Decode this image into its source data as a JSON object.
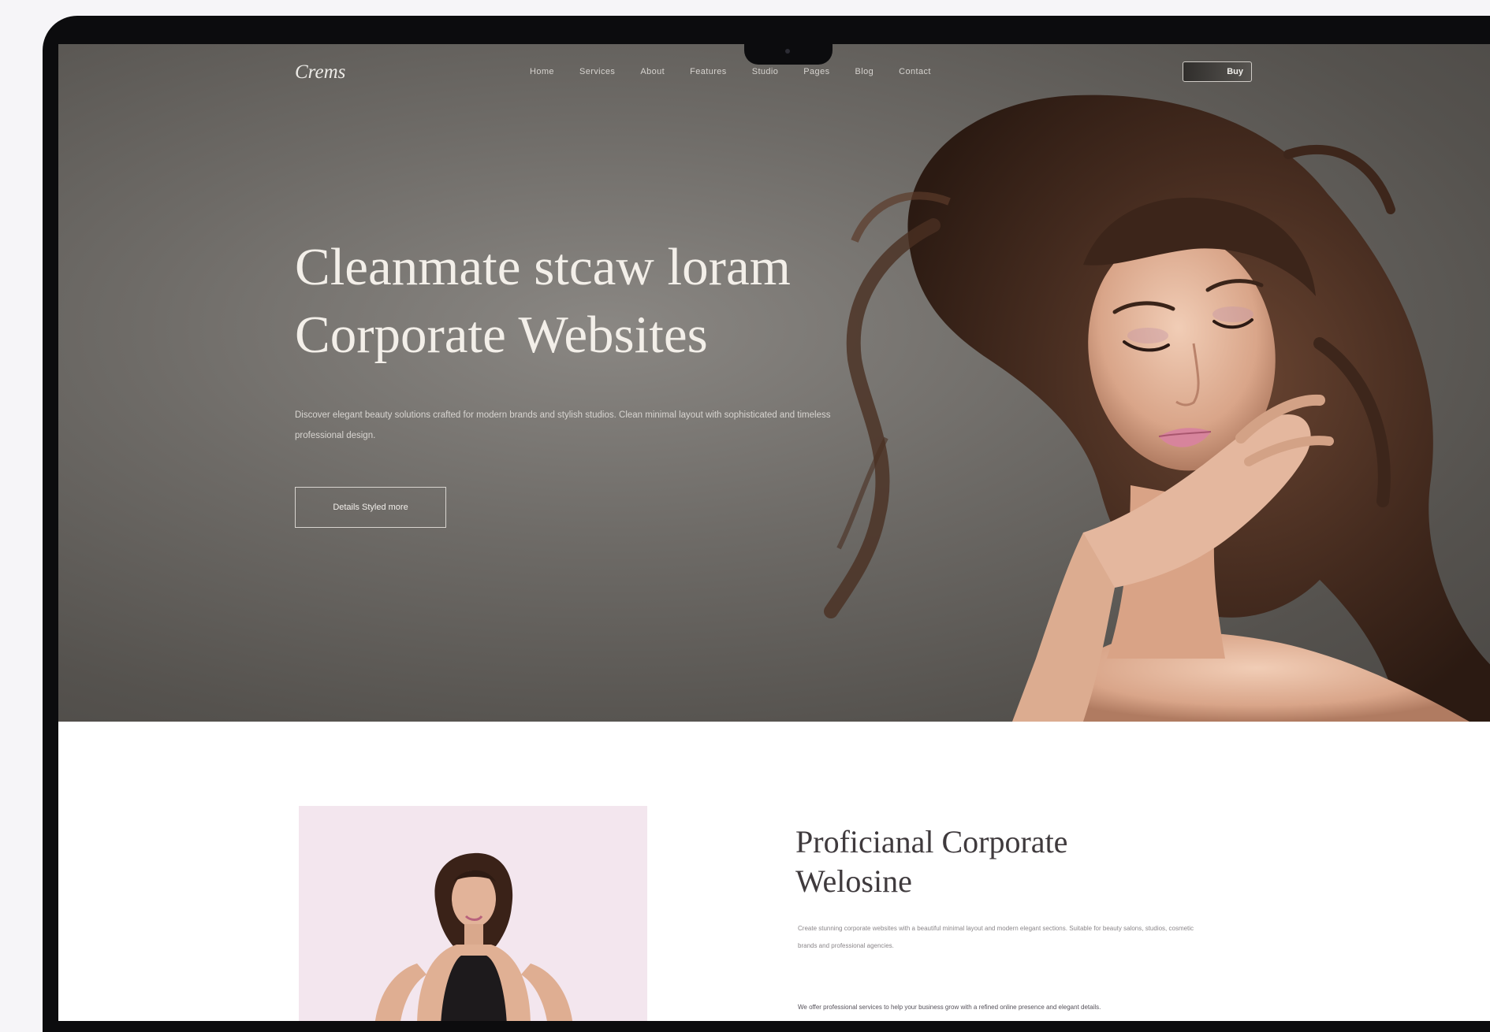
{
  "brand": {
    "logo_text": "Crems"
  },
  "nav": {
    "items": [
      {
        "label": "Home"
      },
      {
        "label": "Services"
      },
      {
        "label": "About"
      },
      {
        "label": "Features"
      },
      {
        "label": "Studio"
      },
      {
        "label": "Pages"
      },
      {
        "label": "Blog"
      },
      {
        "label": "Contact"
      }
    ],
    "cta_label": "Buy"
  },
  "hero": {
    "title_line1": "Cleanmate stcaw loram",
    "title_line2": "Corporate Websites",
    "description": "Discover elegant beauty solutions crafted for modern brands and stylish studios. Clean minimal layout with sophisticated and timeless professional design.",
    "cta_label": "Details Styled more"
  },
  "feature": {
    "title_line1": "Proficianal Corporate",
    "title_line2": "Welosine",
    "description": "Create stunning corporate websites with a beautiful minimal layout and modern elegant sections. Suitable for beauty salons, studios, cosmetic brands and professional agencies.",
    "more_text": "We offer professional services to help your business grow with a refined online presence and elegant details."
  },
  "colors": {
    "hero_background": "#6e6b67",
    "accent_pink": "#f3e6ee",
    "frame": "#0c0c0e"
  },
  "icons": [
    "camera-notch-icon"
  ]
}
